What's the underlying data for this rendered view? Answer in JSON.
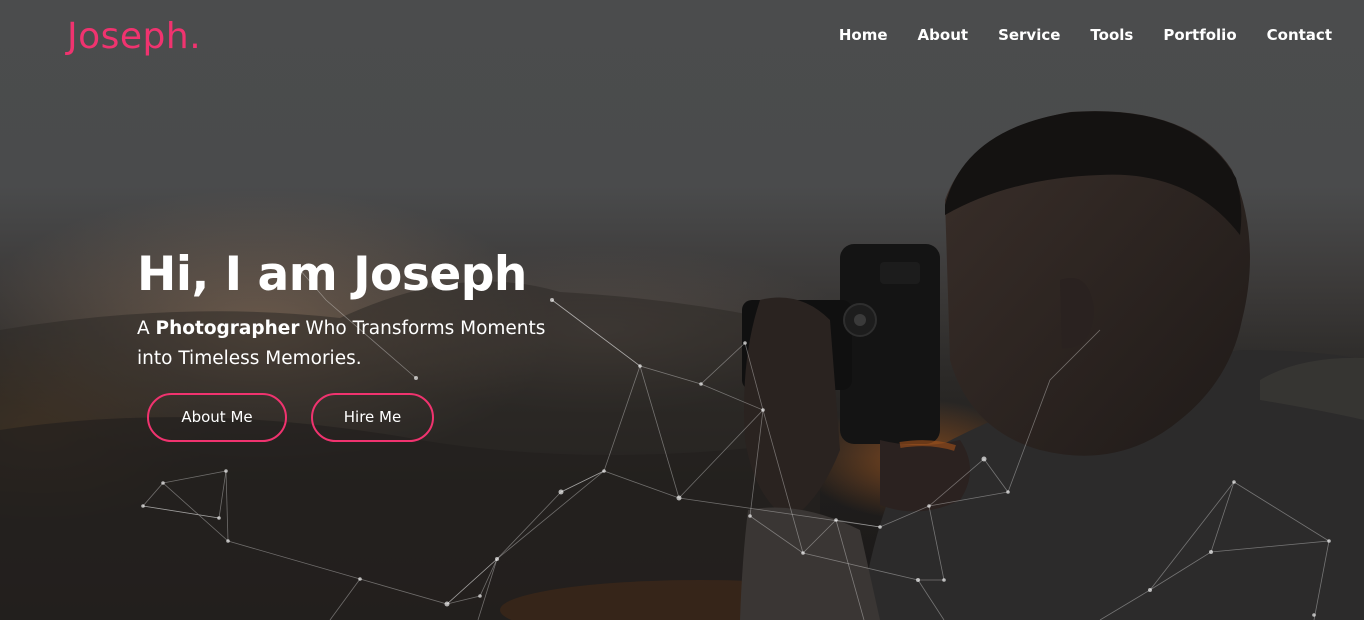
{
  "brand": {
    "logo_text": "Joseph.",
    "accent_color": "#f0336f"
  },
  "nav": {
    "items": [
      {
        "label": "Home"
      },
      {
        "label": "About"
      },
      {
        "label": "Service"
      },
      {
        "label": "Tools"
      },
      {
        "label": "Portfolio"
      },
      {
        "label": "Contact"
      }
    ]
  },
  "hero": {
    "title": "Hi, I am Joseph",
    "subtitle_prefix": "A ",
    "subtitle_highlight": "Photographer",
    "subtitle_rest": " Who Transforms Moments into Timeless Memories.",
    "buttons": {
      "about_label": "About Me",
      "hire_label": "Hire Me"
    }
  }
}
